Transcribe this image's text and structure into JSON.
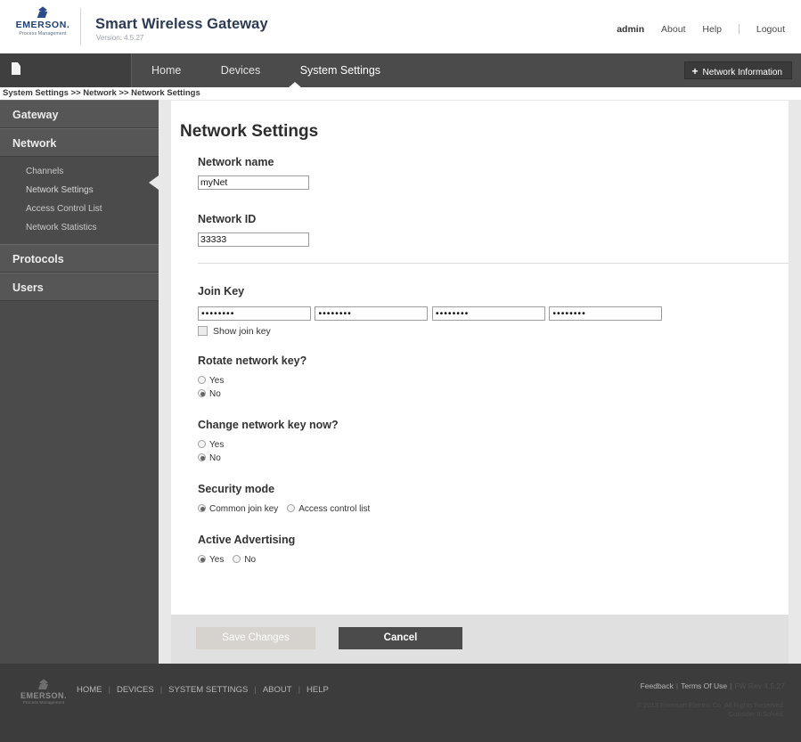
{
  "header": {
    "logo_name": "EMERSON.",
    "logo_sub": "Process Management",
    "app_title": "Smart Wireless Gateway",
    "version": "Version: 4.5.27",
    "user": "admin",
    "about": "About",
    "help": "Help",
    "logout": "Logout"
  },
  "nav": {
    "items": [
      {
        "label": "Home",
        "active": false
      },
      {
        "label": "Devices",
        "active": false
      },
      {
        "label": "System Settings",
        "active": true
      }
    ],
    "network_info_button": "Network Information",
    "plus": "+"
  },
  "breadcrumb": "System Settings >> Network >> Network Settings",
  "sidebar": {
    "groups": [
      {
        "label": "Gateway",
        "items": []
      },
      {
        "label": "Network",
        "items": [
          {
            "label": "Channels",
            "active": false
          },
          {
            "label": "Network Settings",
            "active": true
          },
          {
            "label": "Access Control List",
            "active": false
          },
          {
            "label": "Network Statistics",
            "active": false
          }
        ]
      },
      {
        "label": "Protocols",
        "items": []
      },
      {
        "label": "Users",
        "items": []
      }
    ]
  },
  "page": {
    "title": "Network Settings",
    "network_name_label": "Network name",
    "network_name_value": "myNet",
    "network_id_label": "Network ID",
    "network_id_value": "33333",
    "join_key_label": "Join Key",
    "join_key_values": [
      "••••••••",
      "••••••••",
      "••••••••",
      "••••••••"
    ],
    "show_join_key_label": "Show join key",
    "rotate_key_label": "Rotate network key?",
    "rotate_key_yes": "Yes",
    "rotate_key_no": "No",
    "rotate_key_selected": "No",
    "change_key_label": "Change network key now?",
    "change_key_yes": "Yes",
    "change_key_no": "No",
    "change_key_selected": "No",
    "security_mode_label": "Security mode",
    "security_mode_option1": "Common join key",
    "security_mode_option2": "Access control list",
    "security_mode_selected": "Common join key",
    "active_advertising_label": "Active Advertising",
    "active_advertising_yes": "Yes",
    "active_advertising_no": "No",
    "active_advertising_selected": "Yes"
  },
  "buttons": {
    "save": "Save Changes",
    "cancel": "Cancel"
  },
  "footer": {
    "logo_name": "EMERSON.",
    "logo_sub": "Process Management",
    "links": [
      "HOME",
      "DEVICES",
      "SYSTEM SETTINGS",
      "ABOUT",
      "HELP"
    ],
    "feedback": "Feedback",
    "terms": "Terms Of Use",
    "fw_rev": "FW Rev 4.5.27",
    "copyright_line1": "© 2013 Emerson Electric Co. All Rights Reserved.",
    "copyright_line2": "Consider It Solved."
  },
  "colors": {
    "brand_blue": "#2a4b8d",
    "dark_chrome": "#4b4b4b",
    "panel_bg": "#e8e8e8"
  }
}
